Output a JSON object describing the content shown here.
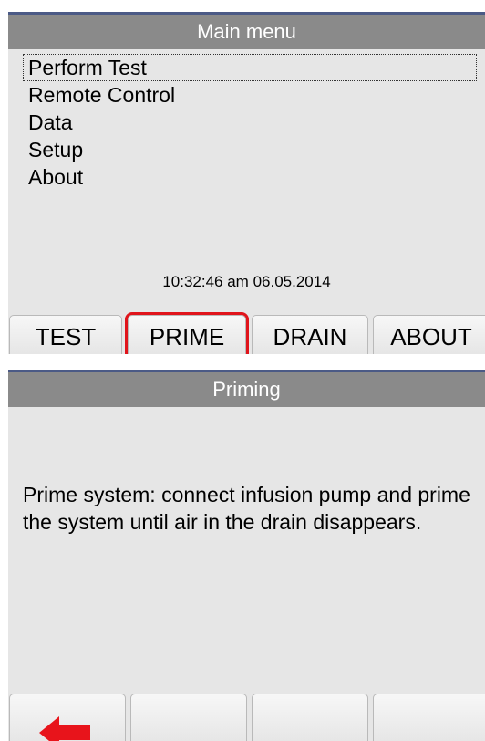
{
  "main_menu": {
    "title": "Main menu",
    "items": [
      {
        "label": "Perform Test",
        "selected": true
      },
      {
        "label": "Remote Control",
        "selected": false
      },
      {
        "label": "Data",
        "selected": false
      },
      {
        "label": "Setup",
        "selected": false
      },
      {
        "label": "About",
        "selected": false
      }
    ],
    "datetime": "10:32:46 am 06.05.2014",
    "buttons": {
      "test": "TEST",
      "prime": "PRIME",
      "drain": "DRAIN",
      "about": "ABOUT"
    },
    "highlight_color": "#e0141b"
  },
  "priming": {
    "title": "Priming",
    "message": "Prime system: connect infusion pump and prime the system until air in the drain disappears.",
    "back_icon": "left-arrow-icon",
    "back_icon_color": "#e8141b"
  }
}
